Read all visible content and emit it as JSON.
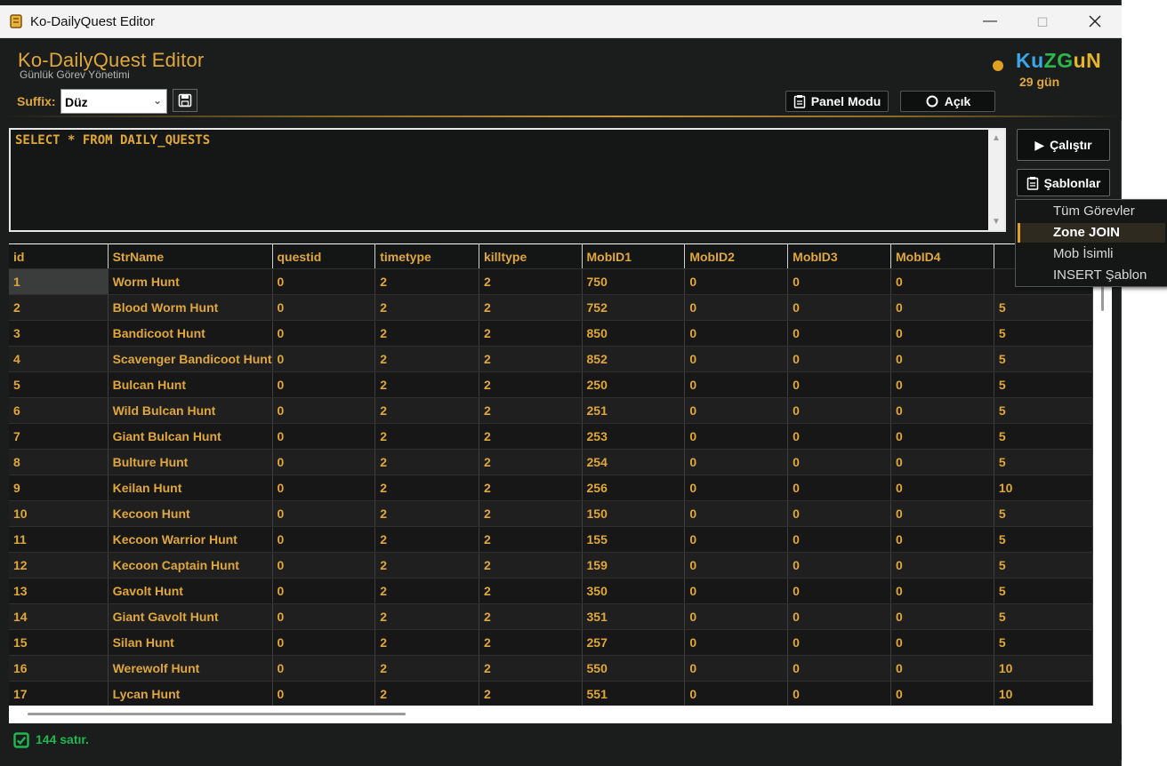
{
  "window": {
    "title": "Ko-DailyQuest Editor"
  },
  "header": {
    "title": "Ko-DailyQuest Editor",
    "subtitle": "Günlük Görev Yönetimi",
    "suffix_label": "Suffix:",
    "suffix_value": "Düz",
    "panel_button": "Panel Modu",
    "theme_button": "Açık",
    "brand": {
      "part1": "Ku",
      "part2": "ZG",
      "part3": "uN"
    },
    "days": "29 gün"
  },
  "editor": {
    "query": "SELECT * FROM DAILY_QUESTS"
  },
  "actions": {
    "run_label": "Çalıştır",
    "templates_label": "Şablonlar"
  },
  "templates_menu": {
    "items": [
      "Tüm Görevler",
      "Zone JOIN",
      "Mob İsimli",
      "INSERT Şablon"
    ],
    "active_index": 1
  },
  "grid": {
    "columns": [
      "id",
      "StrName",
      "questid",
      "timetype",
      "killtype",
      "MobID1",
      "MobID2",
      "MobID3",
      "MobID4",
      ""
    ],
    "rows": [
      [
        "1",
        "Worm Hunt",
        "0",
        "2",
        "2",
        "750",
        "0",
        "0",
        "0",
        ""
      ],
      [
        "2",
        "Blood Worm Hunt",
        "0",
        "2",
        "2",
        "752",
        "0",
        "0",
        "0",
        "5"
      ],
      [
        "3",
        "Bandicoot Hunt",
        "0",
        "2",
        "2",
        "850",
        "0",
        "0",
        "0",
        "5"
      ],
      [
        "4",
        "Scavenger Bandicoot Hunt",
        "0",
        "2",
        "2",
        "852",
        "0",
        "0",
        "0",
        "5"
      ],
      [
        "5",
        "Bulcan Hunt",
        "0",
        "2",
        "2",
        "250",
        "0",
        "0",
        "0",
        "5"
      ],
      [
        "6",
        "Wild Bulcan Hunt",
        "0",
        "2",
        "2",
        "251",
        "0",
        "0",
        "0",
        "5"
      ],
      [
        "7",
        "Giant Bulcan Hunt",
        "0",
        "2",
        "2",
        "253",
        "0",
        "0",
        "0",
        "5"
      ],
      [
        "8",
        "Bulture Hunt",
        "0",
        "2",
        "2",
        "254",
        "0",
        "0",
        "0",
        "5"
      ],
      [
        "9",
        "Keilan Hunt",
        "0",
        "2",
        "2",
        "256",
        "0",
        "0",
        "0",
        "10"
      ],
      [
        "10",
        "Kecoon Hunt",
        "0",
        "2",
        "2",
        "150",
        "0",
        "0",
        "0",
        "5"
      ],
      [
        "11",
        "Kecoon Warrior Hunt",
        "0",
        "2",
        "2",
        "155",
        "0",
        "0",
        "0",
        "5"
      ],
      [
        "12",
        "Kecoon Captain Hunt",
        "0",
        "2",
        "2",
        "159",
        "0",
        "0",
        "0",
        "5"
      ],
      [
        "13",
        "Gavolt Hunt",
        "0",
        "2",
        "2",
        "350",
        "0",
        "0",
        "0",
        "5"
      ],
      [
        "14",
        "Giant Gavolt Hunt",
        "0",
        "2",
        "2",
        "351",
        "0",
        "0",
        "0",
        "5"
      ],
      [
        "15",
        "Silan Hunt",
        "0",
        "2",
        "2",
        "257",
        "0",
        "0",
        "0",
        "5"
      ],
      [
        "16",
        "Werewolf Hunt",
        "0",
        "2",
        "2",
        "550",
        "0",
        "0",
        "0",
        "10"
      ],
      [
        "17",
        "Lycan Hunt",
        "0",
        "2",
        "2",
        "551",
        "0",
        "0",
        "0",
        "10"
      ]
    ]
  },
  "status": {
    "text": "144 satır."
  },
  "colors": {
    "accent": "#e0a73a",
    "success": "#1fb850",
    "background": "#1b1d1c"
  }
}
